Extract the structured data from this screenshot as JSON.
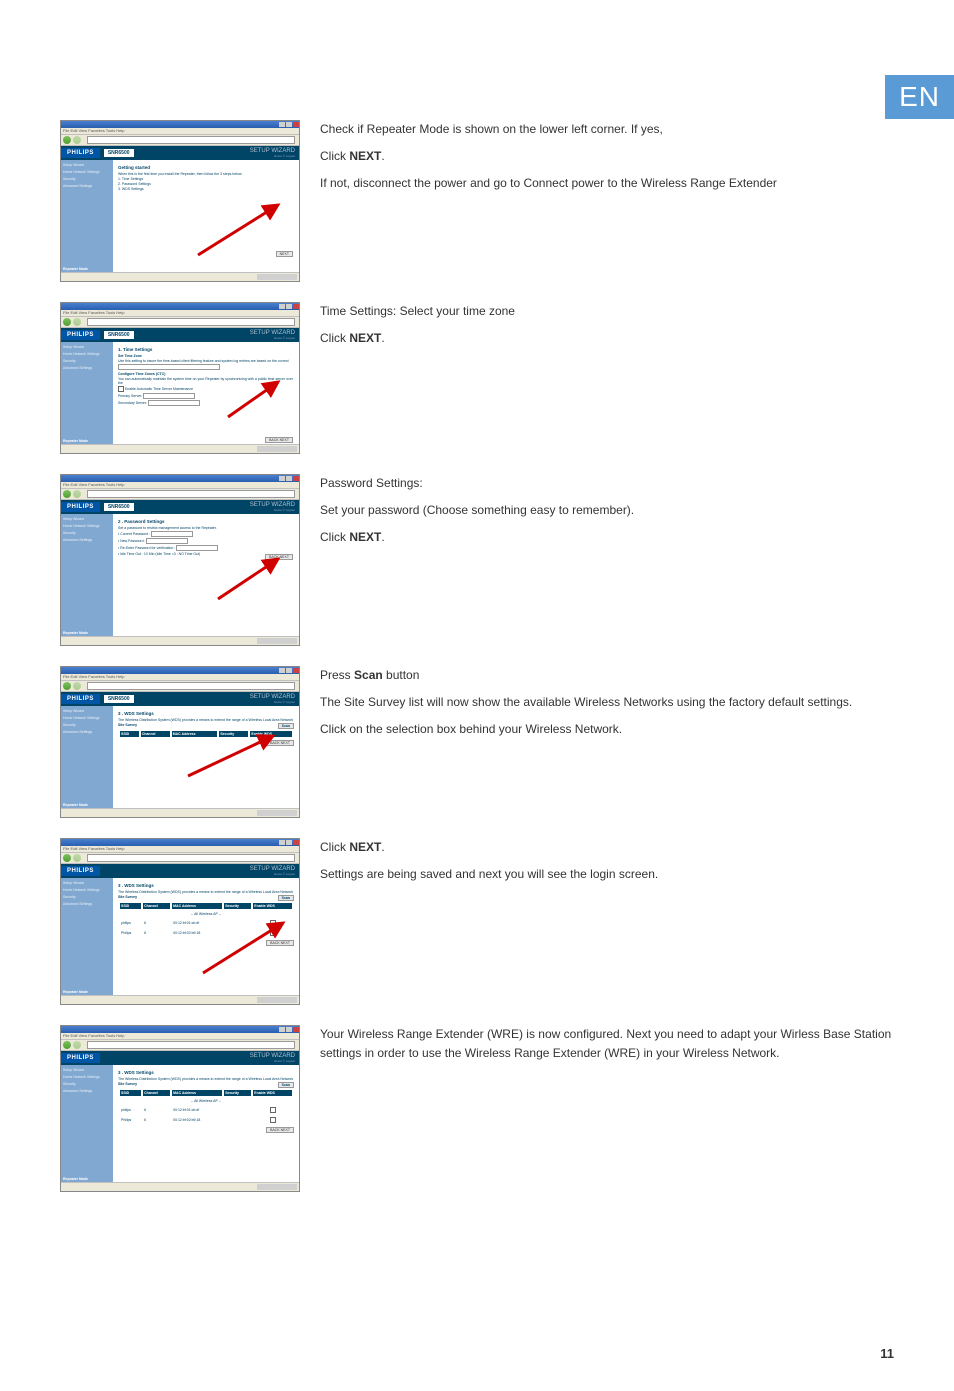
{
  "lang_tag": "EN",
  "page_number": "11",
  "screenshots": {
    "s1": {
      "heading": "Getting started",
      "line1": "When this is the first time you install the Repeater, then follow the 3 steps below.",
      "step_a": "1. Time Settings",
      "step_b": "2. Password Settings",
      "step_c": "3. WDS Settings"
    },
    "s2": {
      "heading": "1. Time Settings",
      "subhead": "Set Time Zone",
      "desc": "Use this setting to insure the time-based client filtering feature and system log entries are based on the correct",
      "ctz_head": "Configure Time Zones (CTC)",
      "ctz_desc": "You can automatically maintain the system time on your Repeater by synchronizing with a public time server over the",
      "check_label": " Enable Automatic Time Server Maintenance",
      "psrv": "Primary Server:",
      "ssrv": "Secondary Server:"
    },
    "s3": {
      "heading": "2 . Password Settings",
      "desc": "Set a password to restrict management access to the Repeater.",
      "f1": "• Current Password :",
      "f2": "• New Password :",
      "f3": "• Re-Enter Password for verification :",
      "f4": "• Idle Time Out : 10 Min (Idle Time =0 : NO Time Out)"
    },
    "s4": {
      "heading": "3 . WDS Settings",
      "desc": "The Wireless Distribution System (WDS) provides a means to extend the range of a Wireless Local Area Network",
      "survey": "Site Survey",
      "col1": "SSID",
      "col2": "Channel",
      "col3": "MAC Address",
      "col4": "Security",
      "col5": "Enable WDS"
    },
    "s5": {
      "heading": "3 . WDS Settings",
      "desc": "The Wireless Distribution System (WDS) provides a means to extend the range of a Wireless Local Area Network",
      "survey": "Site Survey",
      "col1": "SSID",
      "col2": "Channel",
      "col3": "MAC Address",
      "col4": "Security",
      "col5": "Enable WDS",
      "row1_ssid": "philips",
      "row1_ch": "6",
      "row1_mac": "00:12:bf:01:cb:df",
      "row2_ssid": "Philips",
      "row2_ch": "6",
      "row2_mac": "00:12:bf:02:b9:18"
    },
    "s6": {
      "heading": "3 . WDS Settings",
      "desc": "The Wireless Distribution System (WDS) provides a means to extend the range of a Wireless Local Area Network",
      "survey": "Site Survey",
      "col1": "SSID",
      "col2": "Channel",
      "col3": "MAC Address",
      "col4": "Security",
      "col5": "Enable WDS",
      "row1_ssid": "philips",
      "row1_ch": "6",
      "row1_mac": "00:12:bf:01:cb:df",
      "row2_ssid": "Philips",
      "row2_ch": "6",
      "row2_mac": "00:12:bf:02:b9:18"
    },
    "common": {
      "logo": "PHILIPS",
      "model": "SNR6500",
      "wiz": "SETUP WIZARD",
      "home_logout": "Home © Logout",
      "nav_setup_wizard": "Setup Wizard",
      "nav_home_network": "Home Network Settings",
      "nav_security": "Security",
      "nav_advanced": "Advanced Settings",
      "repeater_mode": "Repeater Mode",
      "scan": "Scan",
      "next": "NEXT",
      "back_next": "BACK  NEXT"
    }
  },
  "instructions": {
    "i1_line1": "Check if Repeater Mode is shown on the lower left corner. If yes,",
    "i1_line2_pre": "Click ",
    "i1_line2_bold": "NEXT",
    "i1_line2_post": ".",
    "i1_line3": "If not, disconnect the power and go to Connect power to the Wireless Range Extender",
    "i2_line1": "Time Settings: Select your time zone",
    "i2_line2_pre": "Click ",
    "i2_line2_bold": "NEXT",
    "i2_line2_post": ".",
    "i3_line1": "Password Settings:",
    "i3_line2": "Set your password (Choose something easy to remember).",
    "i3_line3_pre": "Click ",
    "i3_line3_bold": "NEXT",
    "i3_line3_post": ".",
    "i4_line1_pre": "Press ",
    "i4_line1_bold": "Scan",
    "i4_line1_post": " button",
    "i4_line2": "The Site Survey list will now show the available Wireless Networks using the factory default settings.",
    "i4_line3": "Click on the selection box behind your Wireless Network.",
    "i5_line1_pre": "Click ",
    "i5_line1_bold": "NEXT",
    "i5_line1_post": ".",
    "i5_line2": "Settings are being saved and next you will see the login screen.",
    "i6_line1": "Your Wireless Range Extender (WRE) is now configured. Next you need to adapt your Wirless Base Station settings in order to use the Wireless Range Extender (WRE) in your Wireless Network."
  }
}
